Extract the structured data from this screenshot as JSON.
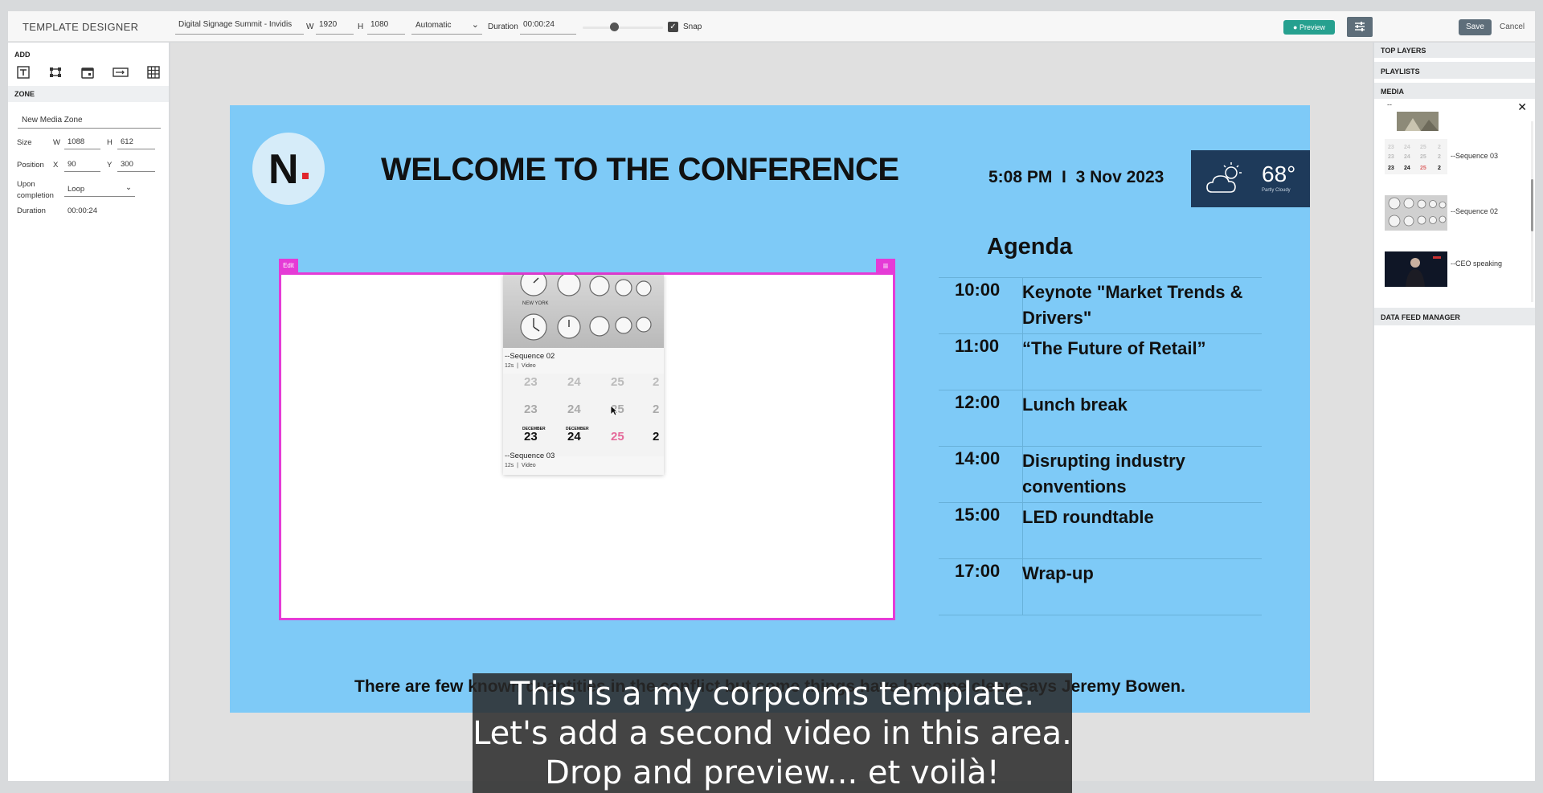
{
  "topbar": {
    "app_title": "TEMPLATE DESIGNER",
    "template_name": "Digital Signage Summit - Invidis",
    "w_label": "W",
    "w_value": "1920",
    "h_label": "H",
    "h_value": "1080",
    "mode_value": "Automatic",
    "duration_label": "Duration",
    "duration_value": "00:00:24",
    "zoom_level": 0.35,
    "snap_label": "Snap",
    "snap_checked": true,
    "preview_label": "Preview",
    "save_label": "Save",
    "cancel_label": "Cancel"
  },
  "left_panel": {
    "add_title": "ADD",
    "add_tools": [
      "text-icon",
      "zone-icon",
      "calendar-icon",
      "ticker-icon",
      "table-icon"
    ],
    "zone_title": "ZONE",
    "zone_name": "New Media Zone",
    "size_label": "Size",
    "w_label": "W",
    "w_value": "1088",
    "h_label": "H",
    "h_value": "612",
    "position_label": "Position",
    "x_label": "X",
    "x_value": "90",
    "y_label": "Y",
    "y_value": "300",
    "upon_completion_label_1": "Upon",
    "upon_completion_label_2": "completion",
    "upon_completion_value": "Loop",
    "duration_label": "Duration",
    "duration_value": "00:00:24"
  },
  "template": {
    "logo_letter": "N",
    "welcome": "WELCOME TO THE CONFERENCE",
    "time": "5:08 PM",
    "separator": "I",
    "date": "3 Nov 2023",
    "weather_temp": "68°",
    "weather_desc": "Partly Cloudy",
    "agenda_title": "Agenda",
    "agenda": [
      {
        "time": "10:00",
        "text": "Keynote \"Market Trends & Drivers\""
      },
      {
        "time": "11:00",
        "text": "“The Future of Retail”"
      },
      {
        "time": "12:00",
        "text": "Lunch break"
      },
      {
        "time": "14:00",
        "text": "Disrupting industry conventions"
      },
      {
        "time": "15:00",
        "text": "LED roundtable"
      },
      {
        "time": "17:00",
        "text": "Wrap-up"
      }
    ],
    "ticker": "There are few known quantities in the conflict but some things have become clear, says Jeremy Bowen.",
    "zone_edit_label": "Edit",
    "drag_card": {
      "thumb1_text": "NEW YORK",
      "item1_label": "--Sequence 02",
      "item1_duration": "12s",
      "item1_type": "Video",
      "item2_label": "--Sequence 03",
      "item2_duration": "12s",
      "item2_type": "Video",
      "cal_rows": [
        {
          "nums": [
            "23",
            "24",
            "25",
            "2"
          ],
          "opacity": 0.35
        },
        {
          "nums": [
            "23",
            "24",
            "25",
            "2"
          ],
          "opacity": 0.5
        },
        {
          "nums": [
            "23",
            "24",
            "25",
            "2"
          ],
          "opacity": 1
        }
      ],
      "cal_month": "DECEMBER"
    }
  },
  "right_panel": {
    "top_layers": "TOP LAYERS",
    "playlists": "PLAYLISTS",
    "media": "MEDIA",
    "media_search": "--",
    "media_items": [
      {
        "label": "--Sequence 03"
      },
      {
        "label": "--Sequence 02"
      },
      {
        "label": "--CEO speaking"
      }
    ],
    "data_feed_manager": "DATA FEED MANAGER"
  },
  "subtitle": {
    "line1": "This is a my corpcoms template.",
    "line2": "Let's add a second video in this area.",
    "line3": "Drop and preview... et voilà!"
  },
  "colors": {
    "template_bg": "#7ecaf7",
    "zone_border": "#e53bd6",
    "preview_btn": "#26a08f",
    "weather_bg": "#1e3a5a",
    "logo_accent": "#e0262d"
  }
}
